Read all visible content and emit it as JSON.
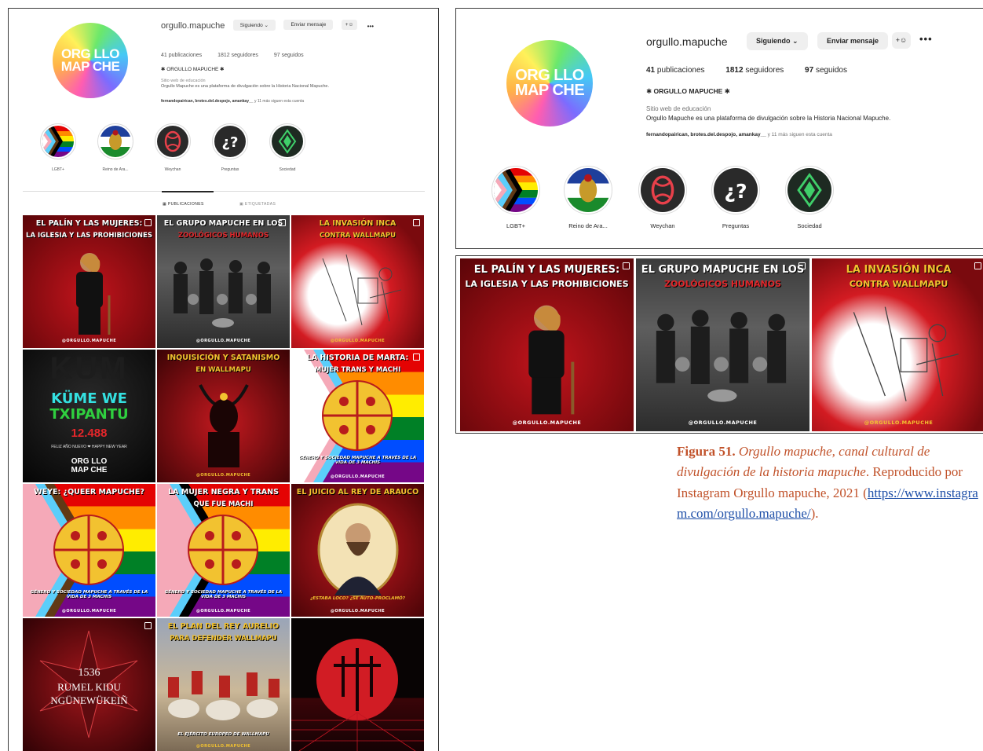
{
  "profile": {
    "username": "orgullo.mapuche",
    "avatar_text_line1": "ORG LLO",
    "avatar_text_line2": "MAP CHE",
    "following_button": "Siguiendo",
    "message_button": "Enviar mensaje",
    "add_user_icon": "+☺",
    "more_icon": "•••",
    "posts_count": "41",
    "posts_label": "publicaciones",
    "followers_count": "1812",
    "followers_label": "seguidores",
    "following_count": "97",
    "following_label": "seguidos",
    "display_name": "✱ ORGULLO MAPUCHE ✱",
    "category": "Sitio web de educación",
    "bio": "Orgullo Mapuche es una plataforma de divulgación sobre la Historia Nacional Mapuche.",
    "followed_by_names": "fernandopairican, brotes.del.despojo, amankay__",
    "followed_by_more": "y 11 más siguen esta cuenta"
  },
  "highlights": [
    {
      "label": "LGBT+",
      "icon": "progress-pride-flag-icon"
    },
    {
      "label": "Reino de Ara...",
      "icon": "coat-of-arms-icon"
    },
    {
      "label": "Weychan",
      "icon": "weychan-symbol-icon"
    },
    {
      "label": "Preguntas",
      "icon": "question-icon"
    },
    {
      "label": "Sociedad",
      "icon": "diamond-icon"
    }
  ],
  "tabs": {
    "posts": "PUBLICACIONES",
    "tagged": "ETIQUETADAS"
  },
  "posts": [
    {
      "title": "EL PALÍN Y LAS MUJERES:",
      "subtitle": "LA IGLESIA Y LAS PROHIBICIONES",
      "footer": "@ORGULLO.MAPUCHE",
      "subtitle_color": "#ffffff"
    },
    {
      "title": "EL GRUPO MAPUCHE EN LOS",
      "subtitle": "ZOOLÓGICOS HUMANOS",
      "footer": "@ORGULLO.MAPUCHE",
      "subtitle_color": "#e0262a"
    },
    {
      "title": "LA INVASIÓN INCA",
      "subtitle": "CONTRA WALLMAPU",
      "footer": "@ORGULLO.MAPUCHE",
      "subtitle_color": "#f2c230"
    },
    {
      "title": "KÜME WE",
      "subtitle": "TXIPANTU",
      "year": "12.488",
      "body": "FELIZ AÑO NUEVO ❤ HAPPY NEW YEAR",
      "logo1": "ORG LLO",
      "logo2": "MAP CHE"
    },
    {
      "title": "INQUISICIÓN Y SATANISMO",
      "subtitle": "EN WALLMAPU",
      "footer": "@ORGULLO.MAPUCHE",
      "subtitle_color": "#f2c230"
    },
    {
      "title": "LA HISTORIA DE MARTA:",
      "subtitle": "MUJER TRANS Y MACHI",
      "body": "GÉNERO Y SOCIEDAD MAPUCHE A TRAVÉS DE LA VIDA DE 3 MACHIS",
      "footer": "@ORGULLO.MAPUCHE",
      "subtitle_color": "#ffffff"
    },
    {
      "title": "WEYE: ¿QUEER MAPUCHE?",
      "subtitle": "",
      "body": "GÉNERO Y SOCIEDAD MAPUCHE A TRAVÉS DE LA VIDA DE 3 MACHIS",
      "footer": "@ORGULLO.MAPUCHE",
      "subtitle_color": "#ffffff"
    },
    {
      "title": "LA MUJER NEGRA Y TRANS",
      "subtitle": "QUE FUE MACHI",
      "body": "GÉNERO Y SOCIEDAD MAPUCHE A TRAVÉS DE LA VIDA DE 3 MACHIS",
      "footer": "@ORGULLO.MAPUCHE",
      "subtitle_color": "#ffffff"
    },
    {
      "title": "EL JUICIO AL REY DE ARAUCO",
      "subtitle": "",
      "body": "¿ESTABA LOCO? ¿SE AUTO-PROCLAMÓ?",
      "footer": "@ORGULLO.MAPUCHE",
      "subtitle_color": "#ffffff"
    },
    {
      "title": "1536",
      "subtitle": "RUMEL KIDU",
      "body": "NGÜNEWÜKEIÑ"
    },
    {
      "title": "EL PLAN DEL REY AURELIO",
      "subtitle": "PARA DEFENDER WALLMAPU",
      "body": "EL EJÉRCITO EUROPEO DE WALLMAPU",
      "footer": "@ORGULLO.MAPUCHE",
      "subtitle_color": "#f2c230"
    },
    {
      "title": "",
      "subtitle": "",
      "footer": ""
    }
  ],
  "caption": {
    "figure": "Figura 51.",
    "title": "Orgullo mapuche, canal cultural de divulgación de la historia mapuche",
    "text": ". Reproducido por Instagram Orgullo mapuche, 2021 (",
    "url": "https://www.instagram.com/orgullo.mapuche/",
    "end": ")."
  },
  "colors": {
    "caption": "#c1522a",
    "link": "#1e4fa8",
    "post_red": "#b3121b",
    "post_yellow": "#f2c230"
  }
}
